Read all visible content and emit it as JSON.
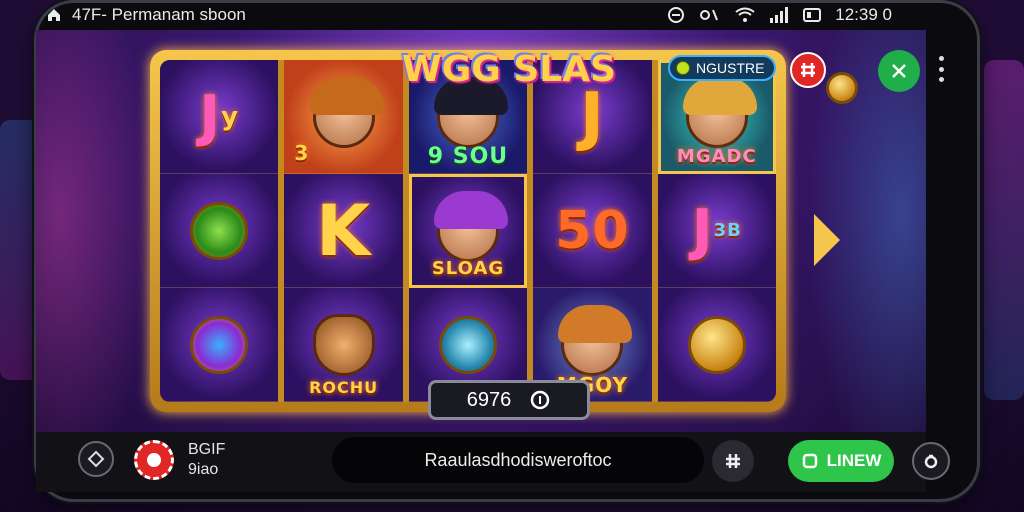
{
  "statusbar": {
    "left_text": "47F- Permanam sboon",
    "time": "12:39 0",
    "icons": [
      "home-icon",
      "do-not-disturb-icon",
      "alarm-icon",
      "wifi-icon",
      "signal-icon",
      "battery-icon"
    ]
  },
  "game": {
    "title": "WGG SLAS",
    "register_label": "NGUSTRE",
    "reels": [
      [
        "Jy",
        "face-brown",
        "coin-spin"
      ],
      [
        "face-blond-33",
        "K",
        "fox"
      ],
      [
        "face-dark-9SOU",
        "face-purple-SLOAG",
        "pot"
      ],
      [
        "J",
        "50",
        "face-boy-MGOY"
      ],
      [
        "face-girl-MGADC",
        "J3",
        "coin-gold"
      ]
    ],
    "symbol_texts": {
      "jy": "J",
      "jy2": "y",
      "s33": "3",
      "s9": "9 SOU",
      "sloag": "SLOAG",
      "mgadc": "MGADC",
      "k": "K",
      "fifty": "50",
      "j": "J",
      "j3": "J",
      "b3": "3B",
      "rochu": "ROCHU",
      "mgoy": "MGOY"
    },
    "balance": "6976",
    "balance_icon": "info-circle-icon"
  },
  "bottombar": {
    "bet_top": "BGIF",
    "bet_bottom": "9iao",
    "message": "Raaulasdhodisweroftoc",
    "spin_label": "LINEW",
    "icons": [
      "diamond-icon",
      "chip-icon",
      "grid-icon",
      "refresh-icon",
      "close-icon",
      "menu-dots-icon",
      "lock-icon"
    ]
  },
  "colors": {
    "accent_gold": "#f5c64b",
    "spin_green": "#2fc54a",
    "close_green": "#1fae4a",
    "chip_red": "#e12626"
  }
}
